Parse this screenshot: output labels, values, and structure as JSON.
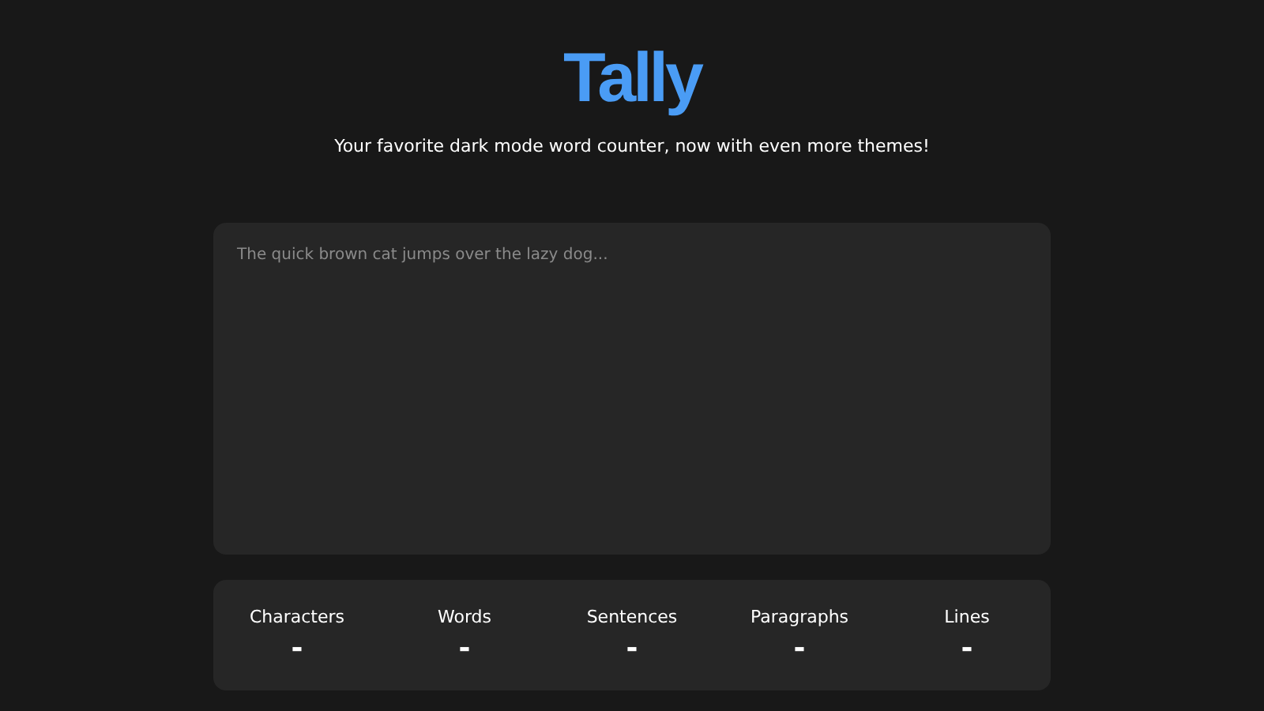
{
  "logo": "Tally",
  "tagline": "Your favorite dark mode word counter, now with even more themes!",
  "editor": {
    "placeholder": "The quick brown cat jumps over the lazy dog..."
  },
  "stats": [
    {
      "label": "Characters",
      "value": "-"
    },
    {
      "label": "Words",
      "value": "-"
    },
    {
      "label": "Sentences",
      "value": "-"
    },
    {
      "label": "Paragraphs",
      "value": "-"
    },
    {
      "label": "Lines",
      "value": "-"
    }
  ]
}
